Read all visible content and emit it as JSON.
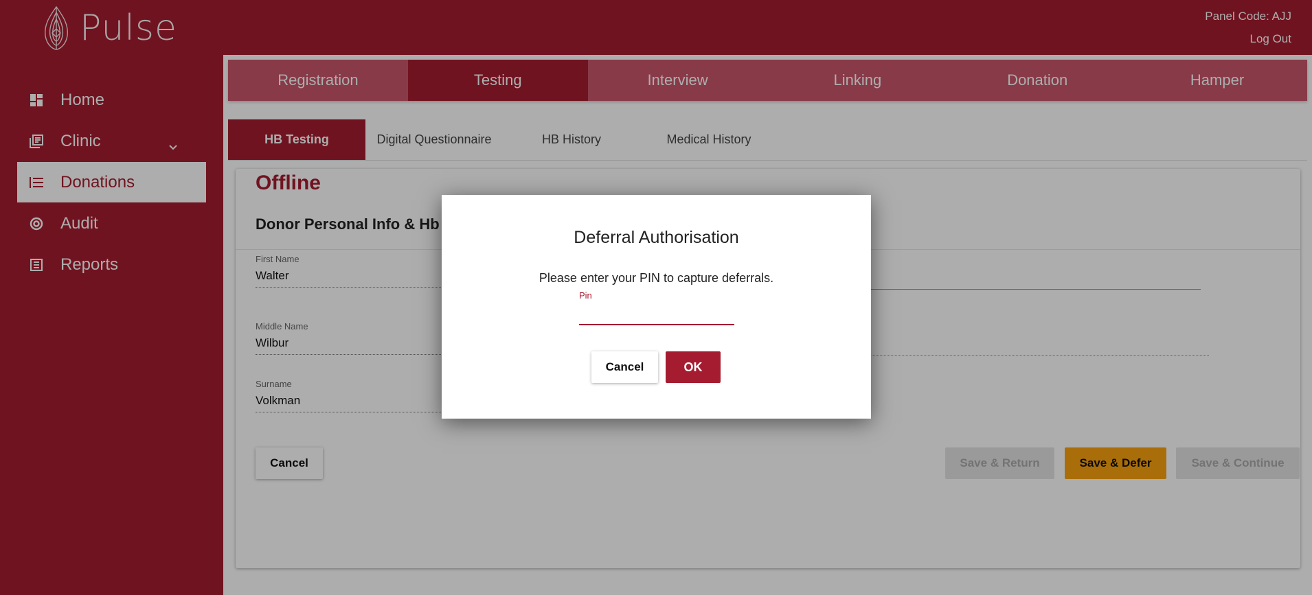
{
  "app": {
    "name": "Pulse"
  },
  "header": {
    "panel_code": "Panel Code: AJJ",
    "logout": "Log Out"
  },
  "sidebar": {
    "items": [
      {
        "label": "Home",
        "icon": "dashboard-icon"
      },
      {
        "label": "Clinic",
        "icon": "library-icon",
        "has_submenu": true
      },
      {
        "label": "Donations",
        "icon": "list-icon",
        "active": true
      },
      {
        "label": "Audit",
        "icon": "donut-icon"
      },
      {
        "label": "Reports",
        "icon": "table-icon"
      }
    ]
  },
  "tabs": [
    {
      "label": "Registration"
    },
    {
      "label": "Testing",
      "active": true
    },
    {
      "label": "Interview"
    },
    {
      "label": "Linking"
    },
    {
      "label": "Donation"
    },
    {
      "label": "Hamper"
    }
  ],
  "subtabs": [
    {
      "label": "HB Testing",
      "active": true
    },
    {
      "label": "Digital Questionnaire"
    },
    {
      "label": "HB History"
    },
    {
      "label": "Medical History"
    }
  ],
  "card": {
    "status": "Offline",
    "section_title": "Donor Personal Info & Hb",
    "fields": [
      {
        "label": "First Name",
        "value": "Walter"
      },
      {
        "label": "Middle Name",
        "value": "Wilbur"
      },
      {
        "label": "Surname",
        "value": "Volkman"
      }
    ],
    "buttons": {
      "cancel": "Cancel",
      "save_return": "Save & Return",
      "save_defer": "Save & Defer",
      "save_continue": "Save & Continue"
    }
  },
  "modal": {
    "title": "Deferral Authorisation",
    "message": "Please enter your PIN to capture deferrals.",
    "pin_label": "Pin",
    "pin_value": "",
    "cancel": "Cancel",
    "ok": "OK"
  },
  "colors": {
    "brand": "#a51c30",
    "accent": "#f9a210",
    "disabled": "#e4e4e4"
  }
}
